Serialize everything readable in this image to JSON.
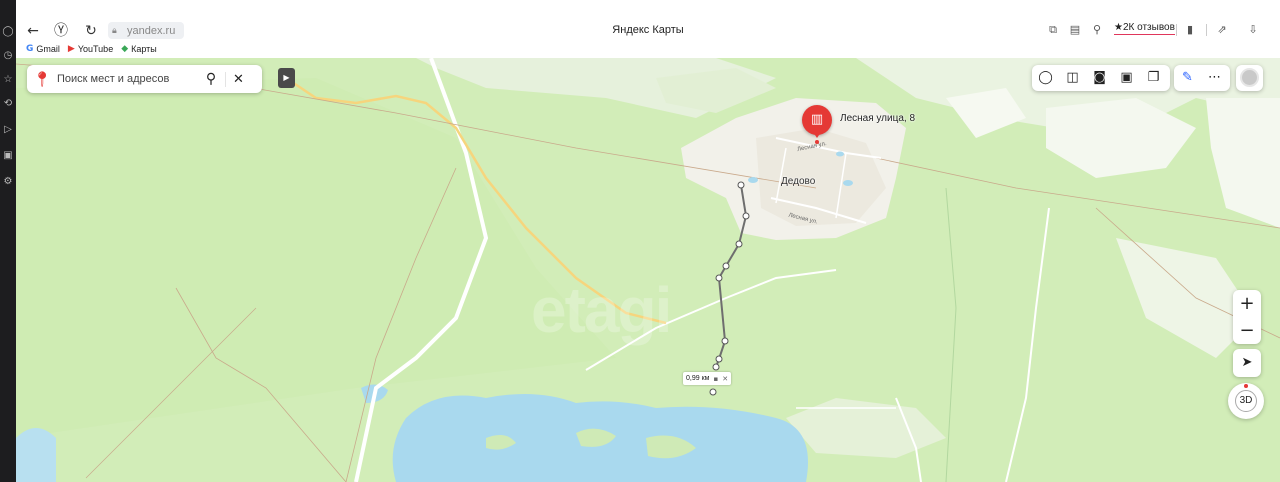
{
  "browser": {
    "url": "yandex.ru",
    "title": "Яндекс Карты",
    "reviews": "2К отзывов",
    "bookmarks": [
      {
        "label": "Gmail",
        "icon": "G",
        "color": "#4285f4"
      },
      {
        "label": "YouTube",
        "icon": "▶",
        "color": "#e53935"
      },
      {
        "label": "Карты",
        "icon": "◆",
        "color": "#3aa757"
      }
    ]
  },
  "map": {
    "search": {
      "placeholder": "Поиск мест и адресов"
    },
    "place": {
      "label": "Лесная улица, 8"
    },
    "village": "Дедово",
    "streets": [
      "Лесная ул.",
      "Лесная ул."
    ],
    "distance": "0,99 км",
    "watermark": "etagi",
    "zoom_in": "+",
    "zoom_out": "−",
    "btn_3d": "3D"
  }
}
